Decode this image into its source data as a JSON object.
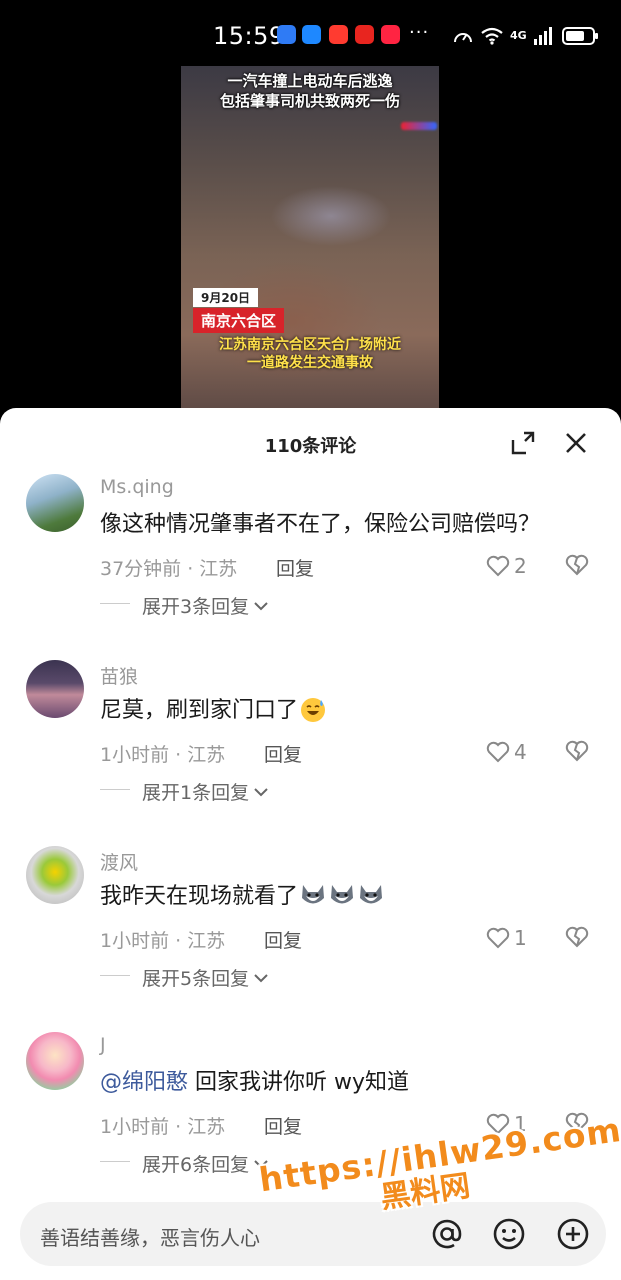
{
  "status_bar": {
    "time": "15:59",
    "dots": "···",
    "network": "4G",
    "battery_level": 0.78,
    "app_icons": [
      "wireless-icon",
      "message-icon",
      "shopping-icon",
      "shopping-icon",
      "xiaohongshu-icon"
    ]
  },
  "video": {
    "title_line1": "一汽车撞上电动车后逃逸",
    "title_line2": "包括肇事司机共致两死一伤",
    "date_tag": "9月20日",
    "location_tag": "南京六合区",
    "caption_line1": "江苏南京六合区天合广场附近",
    "caption_line2": "一道路发生交通事故"
  },
  "comments_panel": {
    "title": "110条评论",
    "reply_label": "回复"
  },
  "comments": [
    {
      "name": "Ms.qing",
      "text": "像这种情况肇事者不在了，保险公司赔偿吗？",
      "time": "37分钟前 · 江苏",
      "likes": "2",
      "expand": "展开3条回复"
    },
    {
      "name": "苗狼",
      "text": "尼莫，刷到家门口了",
      "time": "1小时前 · 江苏",
      "likes": "4",
      "expand": "展开1条回复"
    },
    {
      "name": "渡风",
      "text": "我昨天在现场就看了",
      "time": "1小时前 · 江苏",
      "likes": "1",
      "expand": "展开5条回复"
    },
    {
      "name": "J",
      "mention": "@绵阳憨",
      "text": " 回家我讲你听 wy知道",
      "time": "1小时前 · 江苏",
      "likes": "1",
      "expand": "展开6条回复"
    }
  ],
  "input": {
    "placeholder": "善语结善缘，恶言伤人心"
  },
  "watermark": {
    "url": "https://ihlw29.com",
    "name": "黑料网"
  },
  "colors": {
    "accent_red": "#d8232a",
    "mention_blue": "#3d5a9c",
    "watermark_orange": "#f28b1c"
  }
}
